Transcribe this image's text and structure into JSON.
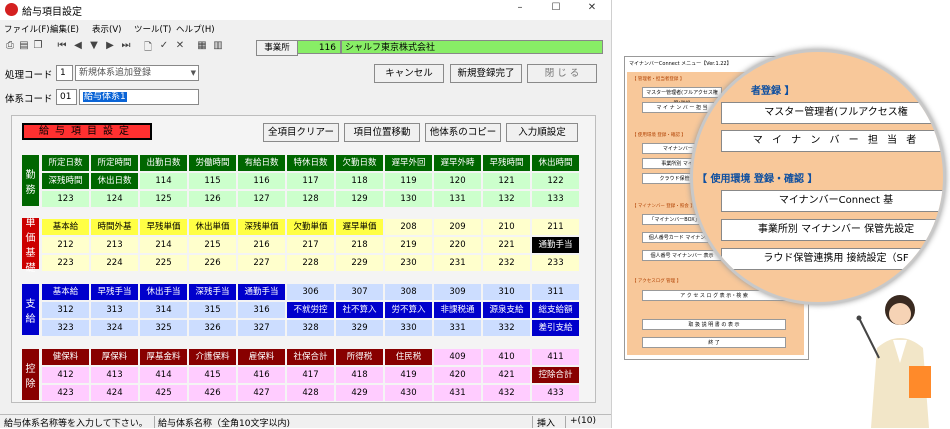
{
  "window": {
    "title": "給与項目設定",
    "min": "–",
    "max": "☐",
    "close": "✕"
  },
  "menu": [
    "ファイル(F)",
    "編集(E)",
    "表示(V)",
    "ツール(T)",
    "ヘルプ(H)"
  ],
  "toolbar": {
    "jigyosho_label": "事業所",
    "jigyosho_code": "116",
    "jigyosho_name": "シャルフ東京株式会社"
  },
  "form": {
    "shori_label": "処理コード",
    "shori_code": "1",
    "shori_value": "新規体系追加登録",
    "taikei_label": "体系コード",
    "taikei_code": "01",
    "taikei_name": "給与体系1",
    "cancel": "キャンセル",
    "complete": "新規登録完了",
    "close": "閉 じ る"
  },
  "panel": {
    "title": "給与項目設定",
    "btn_clear": "全項目クリアー",
    "btn_move": "項目位置移動",
    "btn_copy": "他体系のコピー",
    "btn_order": "入力順設定"
  },
  "groups": {
    "kinmu": "勤務",
    "tanka": "単価基礎",
    "shikyu": "支給",
    "kojo": "控除"
  },
  "grid": {
    "kinmu": [
      [
        "所定日数",
        "所定時間",
        "出勤日数",
        "労働時間",
        "有給日数",
        "特休日数",
        "欠勤日数",
        "遅早外回",
        "遅早外時",
        "早残時間",
        "休出時間"
      ],
      [
        "深残時間",
        "休出日数",
        "114",
        "115",
        "116",
        "117",
        "118",
        "119",
        "120",
        "121",
        "122"
      ],
      [
        "123",
        "124",
        "125",
        "126",
        "127",
        "128",
        "129",
        "130",
        "131",
        "132",
        "133"
      ]
    ],
    "tanka": [
      [
        "基本給",
        "時間外基",
        "早残単価",
        "休出単価",
        "深残単価",
        "欠勤単価",
        "遅早単価",
        "208",
        "209",
        "210",
        "211"
      ],
      [
        "212",
        "213",
        "214",
        "215",
        "216",
        "217",
        "218",
        "219",
        "220",
        "221",
        "通勤手当"
      ],
      [
        "223",
        "224",
        "225",
        "226",
        "227",
        "228",
        "229",
        "230",
        "231",
        "232",
        "233"
      ]
    ],
    "shikyu": [
      [
        "基本給",
        "早残手当",
        "休出手当",
        "深残手当",
        "通勤手当",
        "306",
        "307",
        "308",
        "309",
        "310",
        "311"
      ],
      [
        "312",
        "313",
        "314",
        "315",
        "316",
        "不就労控",
        "社不算入",
        "労不算入",
        "非課税通",
        "源泉支給",
        "総支給額"
      ],
      [
        "323",
        "324",
        "325",
        "326",
        "327",
        "328",
        "329",
        "330",
        "331",
        "332",
        "差引支給"
      ]
    ],
    "kojo": [
      [
        "健保料",
        "厚保料",
        "厚基金料",
        "介護保料",
        "雇保料",
        "社保合計",
        "所得税",
        "住民税",
        "409",
        "410",
        "411"
      ],
      [
        "412",
        "413",
        "414",
        "415",
        "416",
        "417",
        "418",
        "419",
        "420",
        "421",
        "控除合計"
      ],
      [
        "423",
        "424",
        "425",
        "426",
        "427",
        "428",
        "429",
        "430",
        "431",
        "432",
        "433"
      ]
    ]
  },
  "status": {
    "message": "給与体系名称等を入力して下さい。",
    "hint": "給与体系名称（全角10文字以内)",
    "mode": "挿入",
    "count": "+(10)"
  },
  "illustration": {
    "mini_title": "マイナンバーConnect メニュー【Ver.1.22】",
    "mini_h1": "【 管理者・担当者登録 】",
    "mini_b1": "マスター管理者(フルアクセス権限)登録",
    "mini_b2": "マ イ ナ ン バ ー 担 当",
    "mini_h2": "【 使用環境 登録・確認 】",
    "mini_b3": "マイナンバー-Co",
    "mini_b4": "事業所別 マイナン",
    "mini_b5": "クラウド保管連携用",
    "mini_h3": "【 マイナンバー 登録・照会 】",
    "mini_b6": "「マイナンバーBOX」マイナ",
    "mini_b7": "個人番号カード マイナンバー",
    "mini_b8": "個人番号 マイナンバー 表示",
    "mini_h4": "【 アクセスログ 管理 】",
    "mini_b9": "ア ク セ ス ロ グ 表 示・検 索",
    "mini_b10": "取 扱 説 明 書 の 表 示",
    "mini_b11": "終 了",
    "lens_h1": "者登録 】",
    "lens_b1": "マスター管理者(フルアクセス権",
    "lens_b2": "マ イ ナ ン バ ー 担 当 者",
    "lens_h2": "【 使用環境 登録・確認 】",
    "lens_b3": "マイナンバーConnect 基",
    "lens_b4": "事業所別 マイナンバー 保管先設定",
    "lens_b5": "ラウド保管連携用 接続設定（SF"
  },
  "colors": {
    "kinmu_header": "#006600",
    "kinmu_cell": "#ccffcc",
    "tanka_label": "#cc0000",
    "tanka_header": "#ffff44",
    "tanka_cell": "#ffffcc",
    "shikyu_header": "#0000cc",
    "shikyu_cell": "#ccddff",
    "kojo_header": "#880000",
    "kojo_cell": "#ffccff"
  }
}
